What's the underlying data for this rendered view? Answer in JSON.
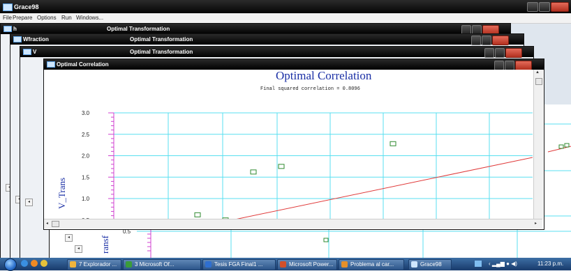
{
  "app": {
    "title": "Grace98",
    "menu": [
      "File",
      "Prepare",
      "Options",
      "Run",
      "Windows..."
    ]
  },
  "windows": [
    {
      "name": "h",
      "title": "Optimal Transformation"
    },
    {
      "name": "Wfraction",
      "title": "Optimal Transformation"
    },
    {
      "name": "V",
      "title": "Optimal Transformation"
    },
    {
      "name": "Optimal Correlation",
      "title": ""
    }
  ],
  "plot": {
    "title": "Optimal Correlation",
    "subtitle": "Final squared correlation =  0.8096",
    "ylabel": "V_Trans",
    "back_ylabel": "ransf",
    "back_tick": "0.5"
  },
  "chart_data": {
    "type": "scatter",
    "ylabel": "V_Trans",
    "yticks": [
      "0.5",
      "1.0",
      "1.5",
      "2.0",
      "2.5",
      "3.0"
    ],
    "ylim": [
      0.5,
      3.0
    ],
    "points": [
      [
        0.6,
        0.62
      ],
      [
        0.8,
        0.5
      ],
      [
        1.0,
        1.62
      ],
      [
        1.2,
        1.75
      ],
      [
        2.0,
        2.28
      ]
    ],
    "fit_line": [
      [
        0.85,
        0.5
      ],
      [
        3.0,
        1.96
      ]
    ],
    "grid": true,
    "colors": {
      "points": "#2f8a2f",
      "line": "#e03a3a",
      "grid": "#58dff0",
      "axis_ticks": "#d040d0"
    }
  },
  "taskbar": {
    "items": [
      {
        "label": "7 Explorador ...",
        "color": "#f0b43c"
      },
      {
        "label": "3 Microsoft Of...",
        "color": "#3a9c3a"
      },
      {
        "label": "Tesis FGA Final1 ...",
        "color": "#2f6fd0"
      },
      {
        "label": "Microsoft Power...",
        "color": "#d2502a"
      },
      {
        "label": "Problema al car...",
        "color": "#e6902a"
      },
      {
        "label": "Grace98",
        "color": "#cfe7ff"
      }
    ],
    "clock": "11:23 p.m."
  }
}
